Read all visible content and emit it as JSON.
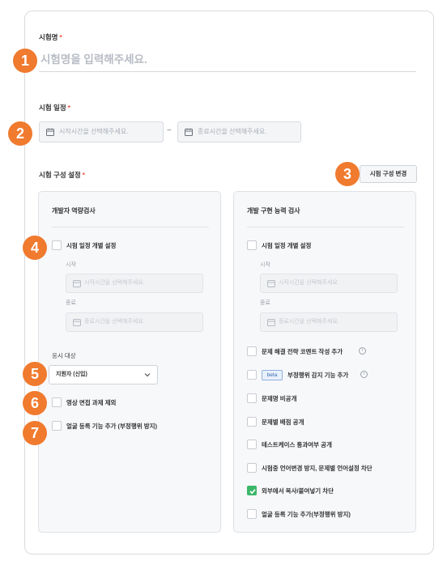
{
  "exam_name": {
    "label": "시험명",
    "required_mark": "*",
    "placeholder": "시험명을 입력해주세요."
  },
  "exam_schedule": {
    "label": "시험 일정",
    "required_mark": "*",
    "start_placeholder": "시작시간을 선택해주세요.",
    "separator": "~",
    "end_placeholder": "종료시간을 선택해주세요."
  },
  "exam_config": {
    "label": "시험 구성 설정",
    "required_mark": "*",
    "change_button": "시험 구성 변경"
  },
  "badges": [
    "1",
    "2",
    "3",
    "4",
    "5",
    "6",
    "7"
  ],
  "left_panel": {
    "title": "개발자 역량검사",
    "individual_schedule": {
      "label": "시험 일정 개별 설정",
      "checked": false
    },
    "start_label": "시작",
    "start_placeholder": "시작시간을 선택해주세요.",
    "end_label": "종료",
    "end_placeholder": "종료시간을 선택해주세요.",
    "target_label": "응시 대상",
    "target_value": "지원자 (신입)",
    "video_interview": {
      "label": "영상 면접 과제 제외",
      "checked": false
    },
    "face_register": {
      "label": "얼굴 등록 기능 추가 (부정행위 방지)",
      "checked": false
    }
  },
  "right_panel": {
    "title": "개발 구현 능력 검사",
    "individual_schedule": {
      "label": "시험 일정 개별 설정",
      "checked": false
    },
    "start_label": "시작",
    "start_placeholder": "시작시간을 선택해주세요.",
    "end_label": "종료",
    "end_placeholder": "종료시간을 선택해주세요.",
    "options": [
      {
        "label": "문제 해결 전략 코멘트 작성 추가",
        "checked": false,
        "info": "i"
      },
      {
        "label": "부정행위 감지 기능 추가",
        "checked": false,
        "info": "i",
        "tag": "beta"
      },
      {
        "label": "문제명 비공개",
        "checked": false
      },
      {
        "label": "문제별 배점 공개",
        "checked": false
      },
      {
        "label": "테스트케이스 통과여부 공개",
        "checked": false
      },
      {
        "label": "시험중 언어변경 방지, 문제별 언어설정 차단",
        "checked": false
      },
      {
        "label": "외부에서 복사/붙여넣기 차단",
        "checked": true
      },
      {
        "label": "얼굴 등록 기능 추가(부정행위 방지)",
        "checked": false
      }
    ]
  },
  "colors": {
    "badge": "#f07a2e",
    "required": "#e8533a",
    "checkbox_checked": "#3bb76a",
    "beta_tag": "#3c6ab3"
  }
}
